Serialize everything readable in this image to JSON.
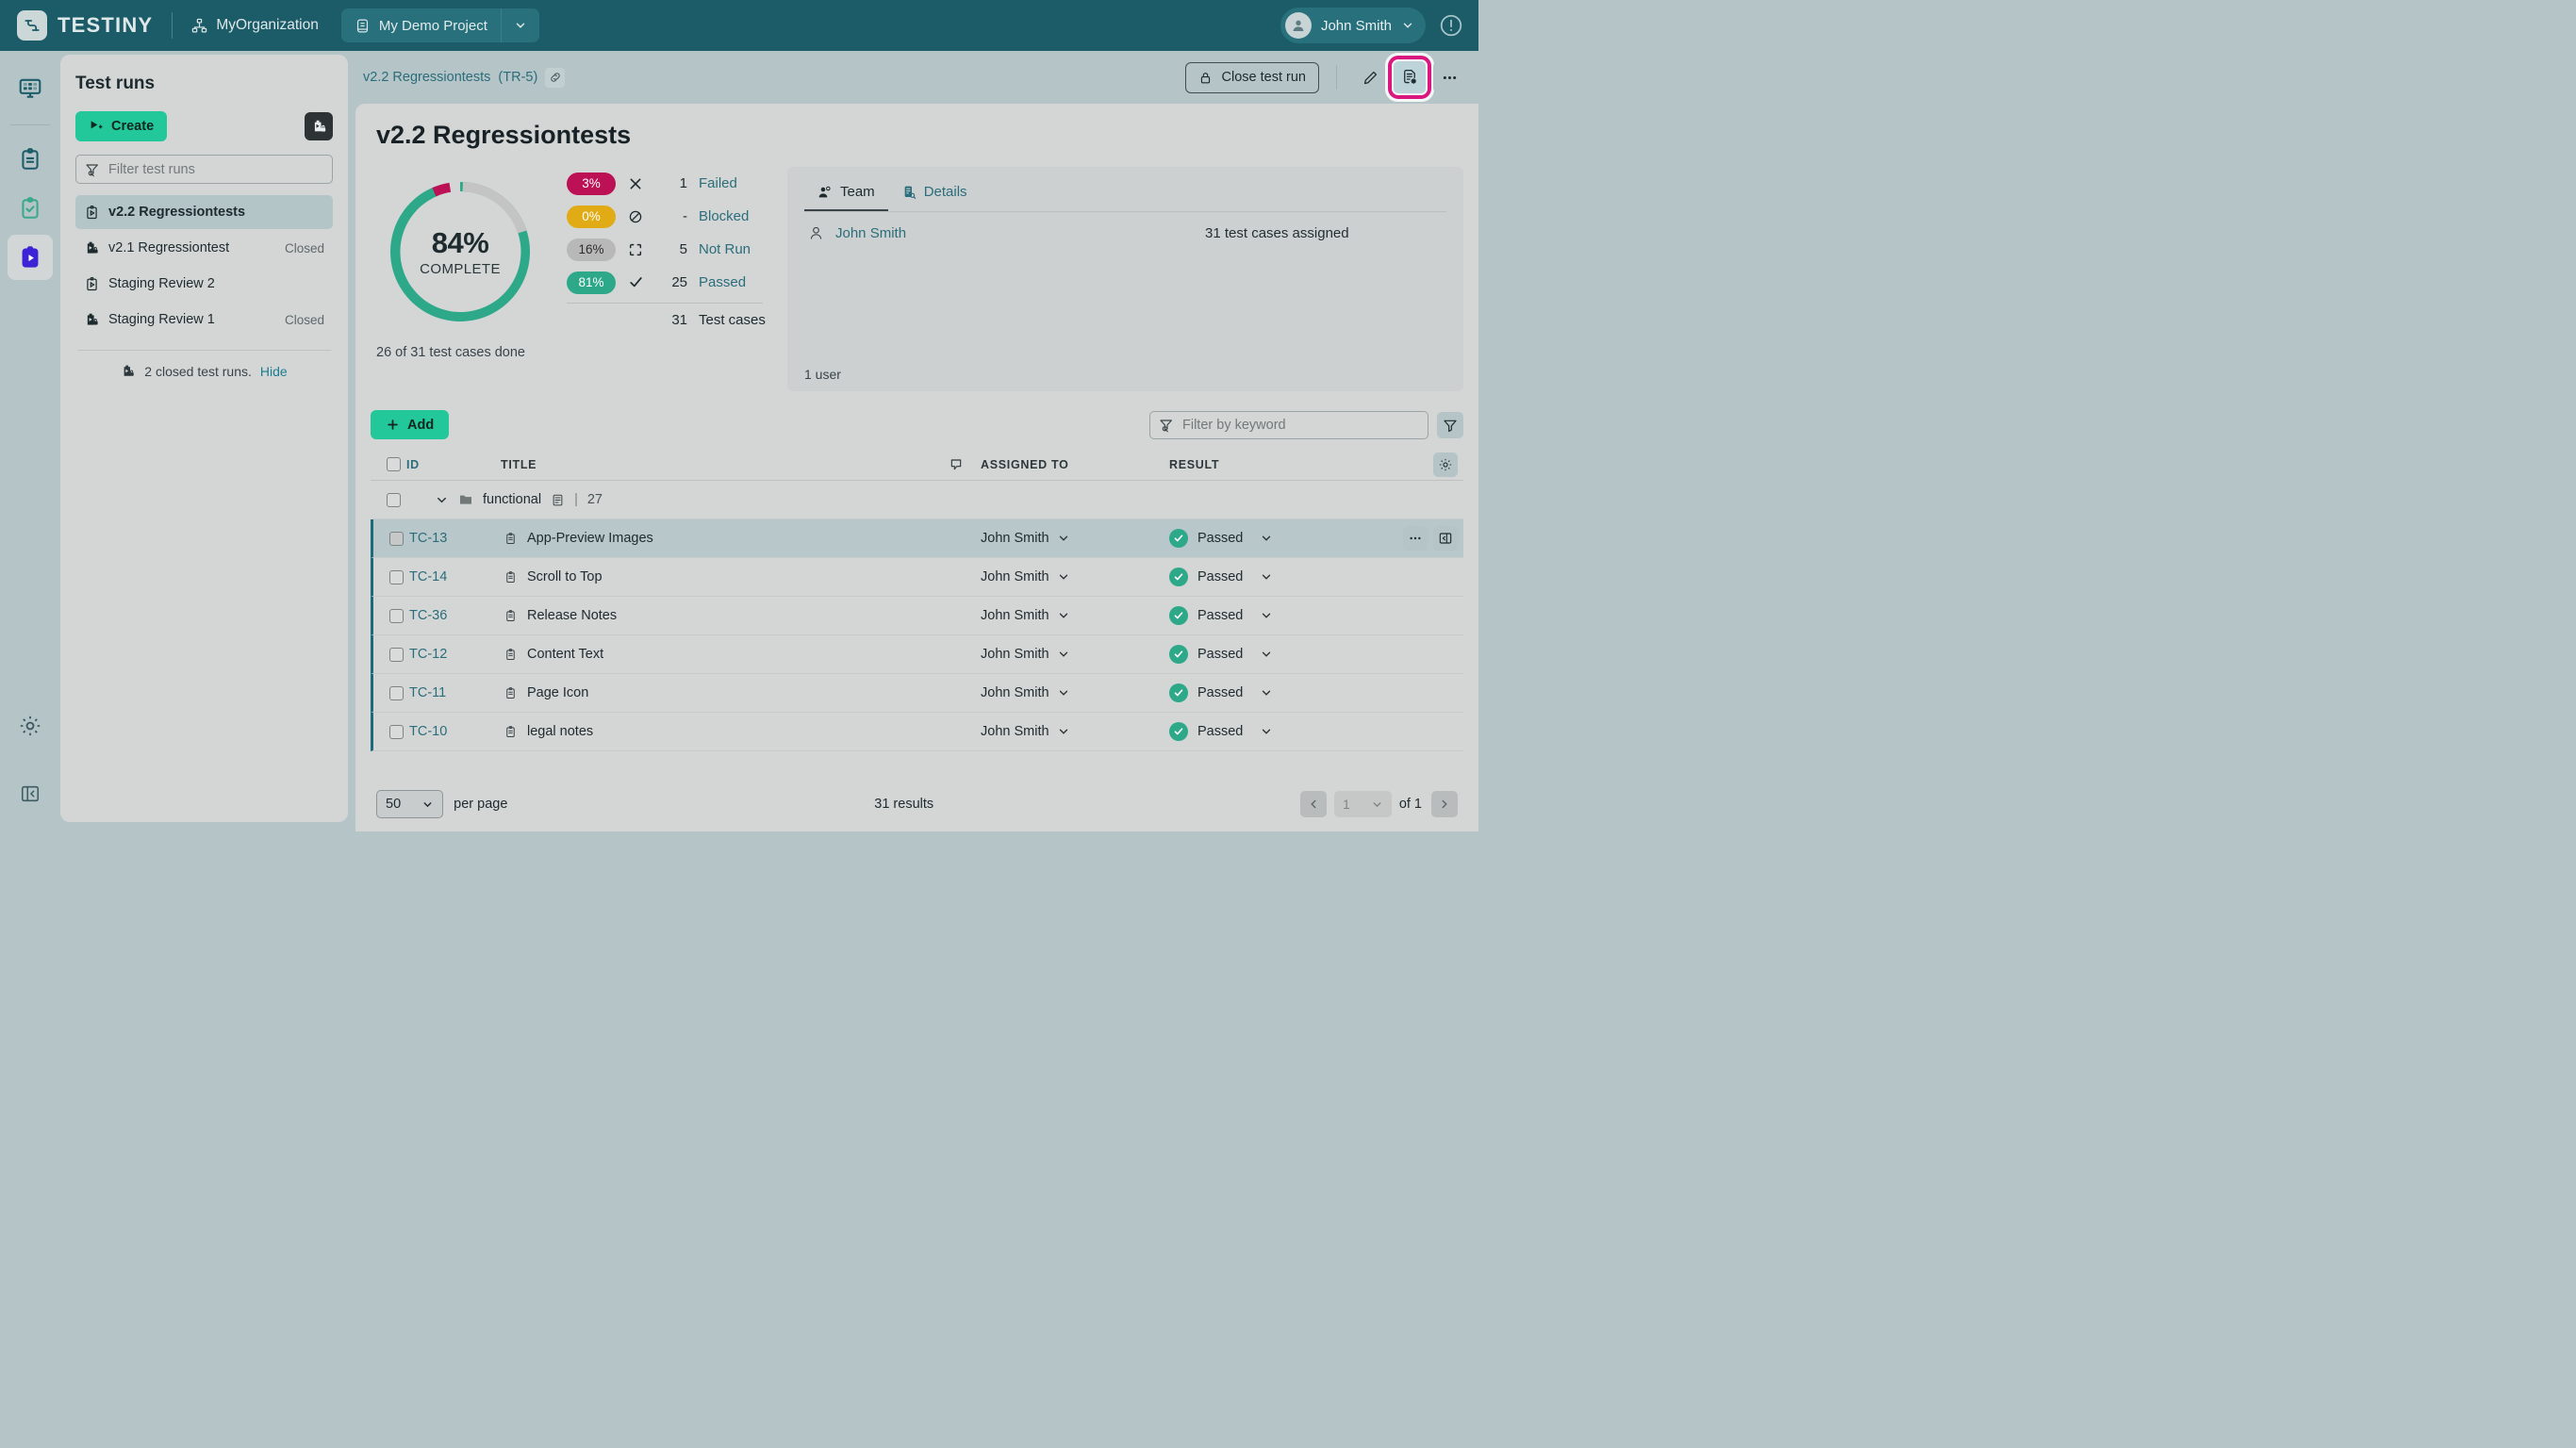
{
  "topbar": {
    "brand": "TESTINY",
    "org": "MyOrganization",
    "project": "My Demo Project",
    "user": "John Smith"
  },
  "sidebar": {
    "title": "Test runs",
    "create_label": "Create",
    "filter_placeholder": "Filter test runs",
    "runs": [
      {
        "name": "v2.2 Regressiontests",
        "status": "",
        "selected": true,
        "closed": false
      },
      {
        "name": "v2.1 Regressiontest",
        "status": "Closed",
        "selected": false,
        "closed": true
      },
      {
        "name": "Staging Review 2",
        "status": "",
        "selected": false,
        "closed": false
      },
      {
        "name": "Staging Review 1",
        "status": "Closed",
        "selected": false,
        "closed": true
      }
    ],
    "closed_note": "2 closed test runs.",
    "closed_hide": "Hide"
  },
  "breadcrumb": {
    "run": "v2.2 Regressiontests",
    "key": "(TR-5)"
  },
  "header_actions": {
    "close_run": "Close test run"
  },
  "page": {
    "title": "v2.2 Regressiontests",
    "done_note": "26 of 31 test cases done"
  },
  "chart_data": {
    "type": "pie",
    "title": "84% COMPLETE",
    "center_value": "84%",
    "center_label": "COMPLETE",
    "categories": [
      "Passed",
      "Failed",
      "Not Run"
    ],
    "values": [
      81,
      3,
      16
    ],
    "colors": [
      "#2da98a",
      "#bd1155",
      "#c4c4c4"
    ],
    "legend_position": "right",
    "legend": [
      {
        "pct": "3%",
        "count": "1",
        "label": "Failed",
        "color": "#bd1155",
        "icon": "close-icon"
      },
      {
        "pct": "0%",
        "count": "-",
        "label": "Blocked",
        "color": "#e0ab15",
        "icon": "blocked-icon"
      },
      {
        "pct": "16%",
        "count": "5",
        "label": "Not Run",
        "color": "#b8b8b8",
        "icon": "not-run-icon"
      },
      {
        "pct": "81%",
        "count": "25",
        "label": "Passed",
        "color": "#2da98a",
        "icon": "check-icon"
      }
    ],
    "total_count": "31",
    "total_label": "Test cases"
  },
  "team": {
    "tabs": [
      {
        "label": "Team",
        "icon": "team-icon",
        "active": true
      },
      {
        "label": "Details",
        "icon": "details-icon",
        "active": false
      }
    ],
    "members": [
      {
        "name": "John Smith",
        "assigned": "31 test cases assigned"
      }
    ],
    "footer": "1 user"
  },
  "toolbar": {
    "add_label": "Add",
    "keyword_placeholder": "Filter by keyword"
  },
  "table": {
    "columns": [
      "ID",
      "TITLE",
      "ASSIGNED TO",
      "RESULT"
    ],
    "group": {
      "name": "functional",
      "count": "27"
    },
    "rows": [
      {
        "id": "TC-13",
        "title": "App-Preview Images",
        "assigned": "John Smith",
        "result": "Passed",
        "selected": true
      },
      {
        "id": "TC-14",
        "title": "Scroll to Top",
        "assigned": "John Smith",
        "result": "Passed",
        "selected": false
      },
      {
        "id": "TC-36",
        "title": "Release Notes",
        "assigned": "John Smith",
        "result": "Passed",
        "selected": false
      },
      {
        "id": "TC-12",
        "title": "Content Text",
        "assigned": "John Smith",
        "result": "Passed",
        "selected": false
      },
      {
        "id": "TC-11",
        "title": "Page Icon",
        "assigned": "John Smith",
        "result": "Passed",
        "selected": false
      },
      {
        "id": "TC-10",
        "title": "legal notes",
        "assigned": "John Smith",
        "result": "Passed",
        "selected": false
      }
    ]
  },
  "footer": {
    "per_page_value": "50",
    "per_page_label": "per page",
    "results": "31 results",
    "page_value": "1",
    "of_label": "of 1"
  }
}
